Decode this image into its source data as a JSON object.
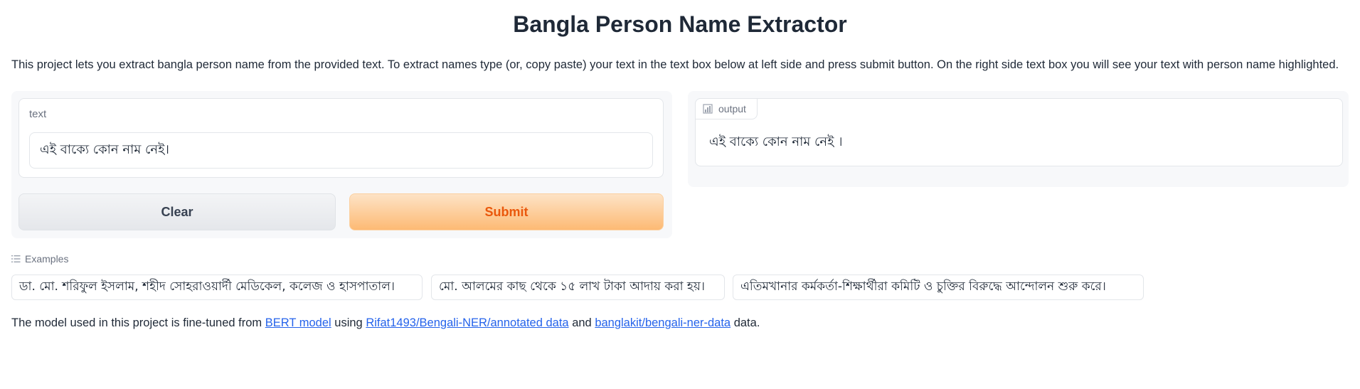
{
  "title": "Bangla Person Name Extractor",
  "description": "This project lets you extract bangla person name from the provided text. To extract names type (or, copy paste) your text in the text box below at left side and press submit button. On the right side text box you will see your text with person name highlighted.",
  "input": {
    "label": "text",
    "value": "এই বাক্যে কোন নাম নেই।"
  },
  "buttons": {
    "clear_label": "Clear",
    "submit_label": "Submit"
  },
  "output": {
    "label": "output",
    "icon": "chart-icon",
    "value": "এই বাক্যে কোন নাম নেই ।"
  },
  "examples": {
    "label": "Examples",
    "icon": "list-icon",
    "items": [
      "ডা. মো. শরিফুল ইসলাম, শহীদ সোহরাওয়ার্দী মেডিকেল, কলেজ ও হাসপাতাল।",
      "মো. আলমের কাছ থেকে ১৫ লাখ টাকা আদায় করা হয়।",
      "এতিমখানার কর্মকর্তা-শিক্ষার্থীরা কমিটি ও চুক্তির বিরুদ্ধে আন্দোলন শুরু করে।"
    ]
  },
  "footer": {
    "text_1": "The model used in this project is fine-tuned from ",
    "link_1": "BERT model",
    "text_2": " using ",
    "link_2": "Rifat1493/Bengali-NER/annotated data",
    "text_3": " and ",
    "link_3": "banglakit/bengali-ner-data",
    "text_4": " data."
  },
  "colors": {
    "submit_text": "#ea580c",
    "link": "#2563eb"
  }
}
